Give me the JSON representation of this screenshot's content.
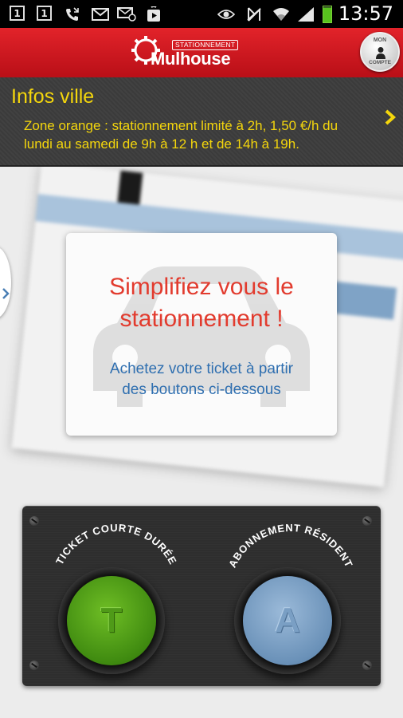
{
  "status_bar": {
    "time": "13:57",
    "notification_1": "1",
    "notification_2": "1",
    "icons": [
      "notification-1-icon",
      "notification-2-icon",
      "missed-call-icon",
      "gmail-icon",
      "email-icon",
      "play-store-icon",
      "eye-icon",
      "mute-icon",
      "wifi-icon",
      "signal-icon",
      "battery-icon"
    ]
  },
  "header": {
    "logo_small": "STATIONNEMENT",
    "logo_big": "Mulhouse",
    "account_top": "MON",
    "account_bottom": "COMPTE",
    "brand_color": "#d21a21"
  },
  "infos": {
    "title": "Infos ville",
    "line1": "Zone orange : stationnement limité à 2h, 1,50 €/h du",
    "line2": "lundi au samedi de 9h à 12 h et de 14h à 19h.",
    "color": "#f4d60c"
  },
  "promo_card": {
    "title_line1": "Simplifiez vous le",
    "title_line2": "stationnement !",
    "subtitle_line1": "Achetez votre ticket à partir",
    "subtitle_line2": "des boutons ci-dessous"
  },
  "actions": {
    "ticket": {
      "label": "TICKET COURTE DURÉE",
      "letter": "T",
      "color": "#4f9a18"
    },
    "subscription": {
      "label": "ABONNEMENT RÉSIDENT",
      "letter": "A",
      "color": "#7a9fc4"
    }
  }
}
